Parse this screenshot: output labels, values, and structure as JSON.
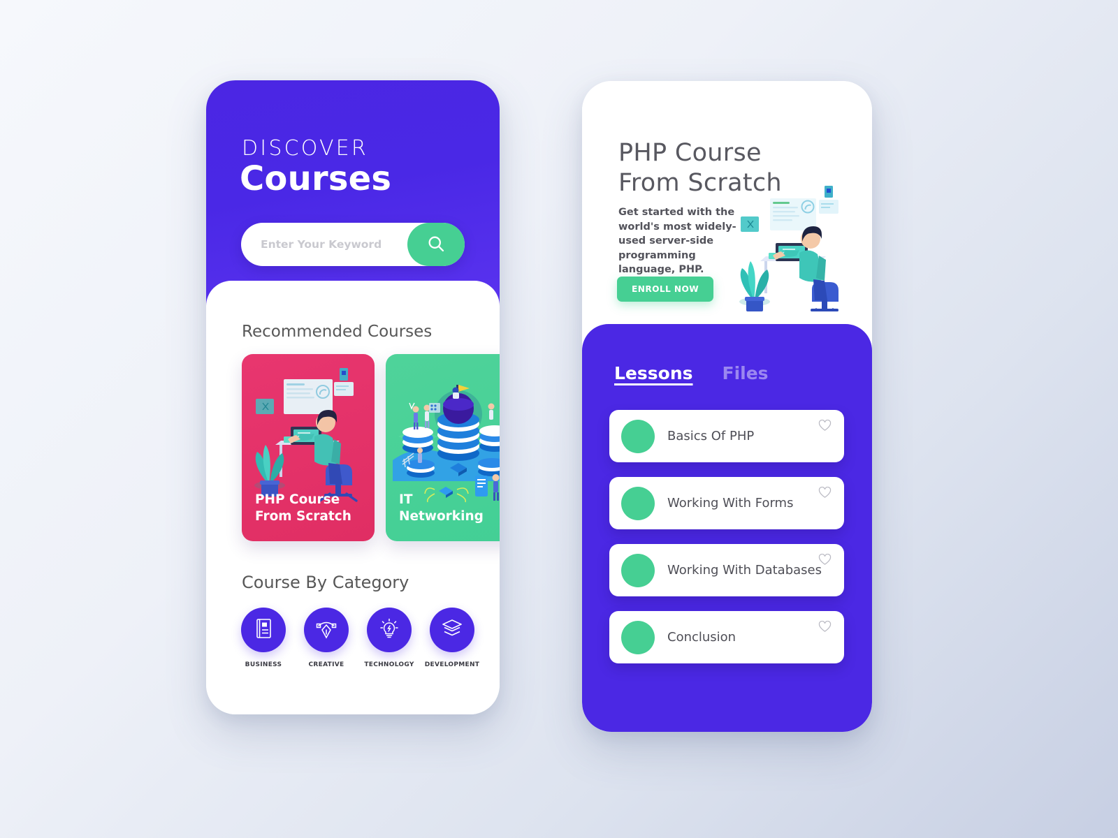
{
  "theme": {
    "purple": "#4b28e4",
    "green": "#46cf93",
    "pink": "#e32e66",
    "page_bg_from": "#f6f8fc",
    "page_bg_to": "#c7cfe3"
  },
  "left_screen": {
    "hero": {
      "eyebrow": "DISCOVER",
      "title": "Courses",
      "search": {
        "value": "",
        "placeholder": "Enter Your Keyword",
        "button_icon": "search-icon"
      }
    },
    "recommended": {
      "heading": "Recommended Courses",
      "cards": [
        {
          "title": "PHP Course\nFrom Scratch",
          "line1": "PHP Course",
          "line2": "From Scratch",
          "color": "#e32e66",
          "illustration": "developer-at-desk-illustration"
        },
        {
          "title": "IT\nNetworking",
          "line1": "IT",
          "line2": "Networking",
          "color": "#46cf93",
          "illustration": "server-network-illustration"
        }
      ]
    },
    "categories": {
      "heading": "Course By Category",
      "items": [
        {
          "label": "BUSINESS",
          "icon": "book-icon"
        },
        {
          "label": "CREATIVE",
          "icon": "pen-tool-icon"
        },
        {
          "label": "TECHNOLOGY",
          "icon": "lightbulb-icon"
        },
        {
          "label": "DEVELOPMENT",
          "icon": "layers-icon"
        }
      ]
    }
  },
  "right_screen": {
    "course": {
      "title_line1": "PHP Course",
      "title_line2": "From Scratch",
      "description": "Get started with the world's most widely-used  server-side programming language, PHP.",
      "enroll_label": "ENROLL NOW",
      "illustration": "developer-at-desk-illustration"
    },
    "tabs": [
      {
        "label": "Lessons",
        "active": true
      },
      {
        "label": "Files",
        "active": false
      }
    ],
    "lessons": [
      {
        "label": "Basics Of PHP",
        "favorite": false
      },
      {
        "label": "Working With Forms",
        "favorite": false
      },
      {
        "label": "Working With Databases",
        "favorite": false
      },
      {
        "label": "Conclusion",
        "favorite": false
      }
    ]
  }
}
